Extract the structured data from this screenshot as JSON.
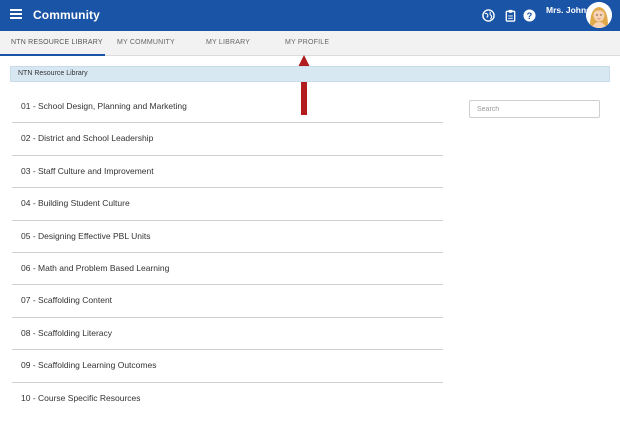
{
  "app": {
    "title": "Community",
    "user_name": "Mrs. Johnson"
  },
  "icons": {
    "menu": "hamburger-menu-icon",
    "globe": "globe-icon",
    "clipboard": "clipboard-icon",
    "help": "help-icon",
    "avatar": "user-avatar"
  },
  "colors": {
    "appbar": "#1a54a6",
    "breadcrumb_bg": "#d8e8f2",
    "annotation_arrow": "#b01c20"
  },
  "tabs": [
    {
      "label": "NTN RESOURCE LIBRARY",
      "active": true
    },
    {
      "label": "MY COMMUNITY",
      "active": false
    },
    {
      "label": "MY LIBRARY",
      "active": false
    },
    {
      "label": "MY PROFILE",
      "active": false
    }
  ],
  "breadcrumb": "NTN Resource Library",
  "search": {
    "placeholder": "Search",
    "value": ""
  },
  "library_items": [
    "01 - School Design, Planning and Marketing",
    "02 - District and School Leadership",
    "03 - Staff Culture and Improvement",
    "04 - Building Student Culture",
    "05 - Designing Effective PBL Units",
    "06 - Math and Problem Based Learning",
    "07 - Scaffolding Content",
    "08 - Scaffolding Literacy",
    "09 - Scaffolding Learning Outcomes",
    "10 - Course Specific Resources"
  ]
}
